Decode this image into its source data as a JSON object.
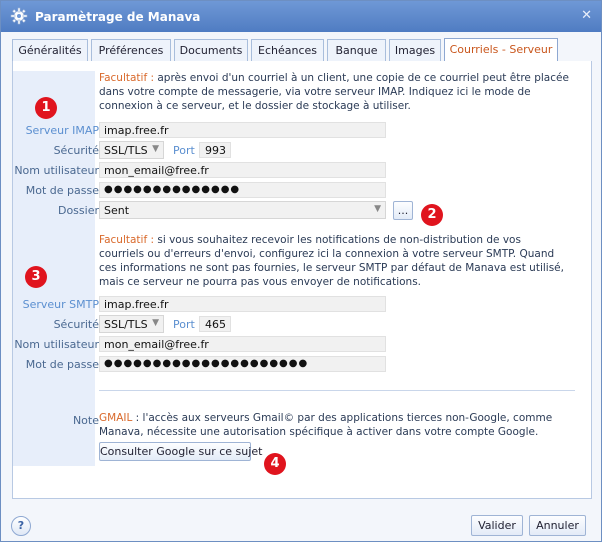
{
  "window": {
    "title": "Paramètrage de Manava",
    "close_glyph": "✕"
  },
  "tabs": [
    {
      "label": "Généralités"
    },
    {
      "label": "Préférences"
    },
    {
      "label": "Documents"
    },
    {
      "label": "Echéances"
    },
    {
      "label": "Banque"
    },
    {
      "label": "Images"
    },
    {
      "label": "Courriels - Serveur",
      "active": true
    }
  ],
  "imap": {
    "note_prefix": "Facultatif :",
    "note": " après envoi d'un courriel à un client, une copie de ce courriel peut être placée dans votre compte de messagerie, via votre serveur IMAP. Indiquez ici le mode de connexion à ce serveur, et le dossier de stockage à utiliser.",
    "labels": {
      "server": "Serveur IMAP",
      "security": "Sécurité",
      "user": "Nom utilisateur",
      "password": "Mot de passe",
      "folder": "Dossier"
    },
    "server": "imap.free.fr",
    "security": "SSL/TLS",
    "port_label": "Port",
    "port": "993",
    "user": "mon_email@free.fr",
    "password": "●●●●●●●●●●●●●●",
    "folder": "Sent",
    "browse_label": "..."
  },
  "smtp": {
    "note_prefix": "Facultatif :",
    "note": " si vous souhaitez recevoir les notifications de non-distribution de vos courriels ou d'erreurs d'envoi, configurez ici la connexion à votre serveur SMTP. Quand ces informations ne sont pas fournies, le serveur SMTP par défaut de Manava est utilisé, mais ce serveur ne pourra pas vous envoyer de notifications.",
    "labels": {
      "server": "Serveur SMTP",
      "security": "Sécurité",
      "user": "Nom utilisateur",
      "password": "Mot de passe"
    },
    "server": "imap.free.fr",
    "security": "SSL/TLS",
    "port_label": "Port",
    "port": "465",
    "user": "mon_email@free.fr",
    "password": "●●●●●●●●●●●●●●●●●●●●●"
  },
  "note_section": {
    "label": "Note",
    "text_prefix": "GMAIL",
    "text": " : l'accès aux serveurs Gmail© par des applications tierces non-Google, comme Manava, nécessite une autorisation spécifique à activer dans votre compte Google.",
    "button": "Consulter Google sur ce sujet"
  },
  "badges": [
    "1",
    "2",
    "3",
    "4"
  ],
  "footer": {
    "help": "?",
    "ok": "Valider",
    "cancel": "Annuler"
  },
  "colors": {
    "accent_orange": "#d9692b",
    "badge_red": "#e0141e",
    "titlebar_blue": "#5a86c9"
  },
  "icons": {
    "window_icon": "gear-icon",
    "close": "close-icon",
    "dropdown": "chevron-down-icon"
  }
}
